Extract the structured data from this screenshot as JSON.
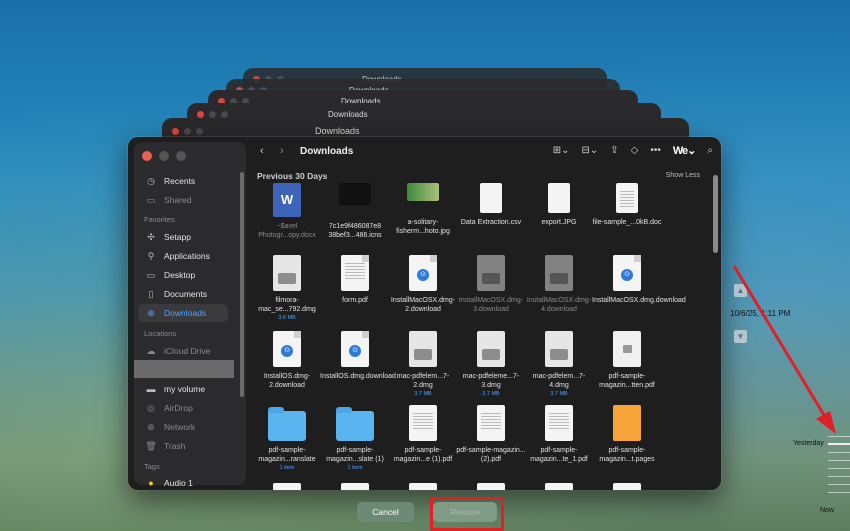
{
  "stack_windows": [
    {
      "title": "Downloads"
    },
    {
      "title": "Downloads"
    },
    {
      "title": "Downloads"
    },
    {
      "title": "Downloads"
    },
    {
      "title": "Downloads"
    }
  ],
  "window": {
    "title": "Downloads",
    "section_title": "Previous 30 Days",
    "show_less": "Show Less"
  },
  "sidebar": {
    "favorites_header": "Favorites",
    "locations_header": "Locations",
    "tags_header": "Tags",
    "top_items": [
      {
        "label": "Recents",
        "icon": "clock-icon"
      },
      {
        "label": "Shared",
        "icon": "shared-folder-icon"
      }
    ],
    "favorites": [
      {
        "label": "Setapp",
        "icon": "setapp-icon"
      },
      {
        "label": "Applications",
        "icon": "applications-icon"
      },
      {
        "label": "Desktop",
        "icon": "desktop-icon"
      },
      {
        "label": "Documents",
        "icon": "document-icon"
      },
      {
        "label": "Downloads",
        "icon": "downloads-icon",
        "active": true
      }
    ],
    "locations": [
      {
        "label": "iCloud Drive",
        "icon": "cloud-icon"
      },
      {
        "label": "my volume",
        "icon": "drive-icon"
      },
      {
        "label": "AirDrop",
        "icon": "airdrop-icon"
      },
      {
        "label": "Network",
        "icon": "network-icon"
      },
      {
        "label": "Trash",
        "icon": "trash-icon"
      }
    ],
    "tags": [
      {
        "label": "Audio 1",
        "color": "#f5d400"
      }
    ]
  },
  "files": {
    "row1": [
      {
        "name": "~$avel Photogr...opy.docx",
        "kind": "word"
      },
      {
        "name": "7c1e9f486087e8 38bef3...486.icns",
        "kind": "dark"
      },
      {
        "name": "a-solitary-fisherm...hoto.jpg",
        "kind": "photo"
      },
      {
        "name": "Data Extraction.csv",
        "kind": "doc"
      },
      {
        "name": "export.JPG",
        "kind": "doc"
      },
      {
        "name": "file-sample_...0kB.doc",
        "kind": "doc"
      }
    ],
    "row2": [
      {
        "name": "filmora-mac_se...792.dmg",
        "size": "3.6 MB",
        "kind": "dmg"
      },
      {
        "name": "form.pdf",
        "kind": "pdf"
      },
      {
        "name": "InstallMacOSX.dmg-2.download",
        "kind": "doc-badge"
      },
      {
        "name": "InstallMacOSX.dmg-3.download",
        "kind": "dmg",
        "dim": true
      },
      {
        "name": "InstallMacOSX.dmg-4.download",
        "kind": "dmg",
        "dim": true
      },
      {
        "name": "InstallMacOSX.dmg.download",
        "kind": "doc-badge"
      }
    ],
    "row3": [
      {
        "name": "InstallOS.dmg-2.download",
        "kind": "doc-badge"
      },
      {
        "name": "InstallOS.dmg.download",
        "kind": "doc-badge"
      },
      {
        "name": "mac-pdfelem...7-2.dmg",
        "size": "3.7 MB",
        "kind": "dmg"
      },
      {
        "name": "mac-pdfeleme...7-3.dmg",
        "size": "3.7 MB",
        "kind": "dmg"
      },
      {
        "name": "mac-pdfelem...7-4.dmg",
        "size": "3.7 MB",
        "kind": "dmg"
      },
      {
        "name": "pdf-sample-magazin...tten.pdf",
        "kind": "lock"
      }
    ],
    "row4": [
      {
        "name": "pdf-sample-magazin...ranslate",
        "size": "1 item",
        "kind": "folder"
      },
      {
        "name": "pdf-sample-magazin...slate (1)",
        "size": "1 item",
        "kind": "folder"
      },
      {
        "name": "pdf-sample-magazin...e (1).pdf",
        "kind": "pdf"
      },
      {
        "name": "pdf-sample-magazin...(2).pdf",
        "kind": "pdf"
      },
      {
        "name": "pdf-sample-magazin...te_1.pdf",
        "kind": "pdf"
      },
      {
        "name": "pdf-sample-magazin...t.pages",
        "kind": "pages"
      }
    ]
  },
  "buttons": {
    "cancel": "Cancel",
    "restore": "Restore"
  },
  "timemachine": {
    "date": "10/6/25, 1:11 PM",
    "yesterday": "Yesterday",
    "now": "Now"
  },
  "accent": "#4aa3ff",
  "highlight": "#e01f26"
}
